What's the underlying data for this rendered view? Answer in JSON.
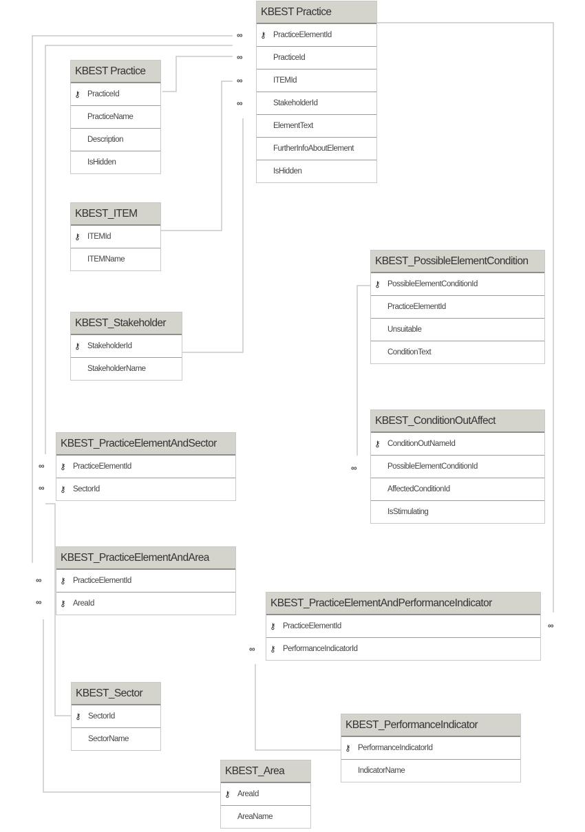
{
  "diagram": {
    "type": "database-schema",
    "line_color": "#c8c8c8",
    "header_color": "#d4d3cc",
    "key_icon": "primary-key-icon",
    "relationship_end_symbol": "∞",
    "tables": [
      {
        "id": "practice_element",
        "name": "KBEST Practice",
        "columns": [
          {
            "name": "PracticeElementId",
            "key": true
          },
          {
            "name": "PracticeId",
            "key": false
          },
          {
            "name": "ITEMId",
            "key": false
          },
          {
            "name": "StakeholderId",
            "key": false
          },
          {
            "name": "ElementText",
            "key": false
          },
          {
            "name": "FurtherInfoAboutElement",
            "key": false
          },
          {
            "name": "IsHidden",
            "key": false
          }
        ]
      },
      {
        "id": "practice",
        "name": "KBEST Practice",
        "columns": [
          {
            "name": "PracticeId",
            "key": true
          },
          {
            "name": "PracticeName",
            "key": false
          },
          {
            "name": "Description",
            "key": false
          },
          {
            "name": "IsHidden",
            "key": false
          }
        ]
      },
      {
        "id": "item",
        "name": "KBEST_ITEM",
        "columns": [
          {
            "name": "ITEMId",
            "key": true
          },
          {
            "name": "ITEMName",
            "key": false
          }
        ]
      },
      {
        "id": "stakeholder",
        "name": "KBEST_Stakeholder",
        "columns": [
          {
            "name": "StakeholderId",
            "key": true
          },
          {
            "name": "StakeholderName",
            "key": false
          }
        ]
      },
      {
        "id": "possible_element_condition",
        "name": "KBEST_PossibleElementCondition",
        "columns": [
          {
            "name": "PossibleElementConditionId",
            "key": true
          },
          {
            "name": "PracticeElementId",
            "key": false
          },
          {
            "name": "Unsuitable",
            "key": false
          },
          {
            "name": "ConditionText",
            "key": false
          }
        ]
      },
      {
        "id": "condition_out_affect",
        "name": "KBEST_ConditionOutAffect",
        "columns": [
          {
            "name": "ConditionOutNameId",
            "key": true
          },
          {
            "name": "PossibleElementConditionId",
            "key": false
          },
          {
            "name": "AffectedConditionId",
            "key": false
          },
          {
            "name": "IsStimulating",
            "key": false
          }
        ]
      },
      {
        "id": "pe_sector",
        "name": "KBEST_PracticeElementAndSector",
        "columns": [
          {
            "name": "PracticeElementId",
            "key": true
          },
          {
            "name": "SectorId",
            "key": true
          }
        ]
      },
      {
        "id": "pe_area",
        "name": "KBEST_PracticeElementAndArea",
        "columns": [
          {
            "name": "PracticeElementId",
            "key": true
          },
          {
            "name": "AreaId",
            "key": true
          }
        ]
      },
      {
        "id": "pe_indicator",
        "name": "KBEST_PracticeElementAndPerformanceIndicator",
        "columns": [
          {
            "name": "PracticeElementId",
            "key": true
          },
          {
            "name": "PerformanceIndicatorId",
            "key": true
          }
        ]
      },
      {
        "id": "sector",
        "name": "KBEST_Sector",
        "columns": [
          {
            "name": "SectorId",
            "key": true
          },
          {
            "name": "SectorName",
            "key": false
          }
        ]
      },
      {
        "id": "indicator",
        "name": "KBEST_PerformanceIndicator",
        "columns": [
          {
            "name": "PerformanceIndicatorId",
            "key": true
          },
          {
            "name": "IndicatorName",
            "key": false
          }
        ]
      },
      {
        "id": "area",
        "name": "KBEST_Area",
        "columns": [
          {
            "name": "AreaId",
            "key": true
          },
          {
            "name": "AreaName",
            "key": false
          }
        ]
      }
    ],
    "relationships": [
      {
        "from": "practice.PracticeId",
        "to": "practice_element.PracticeId",
        "cardinality": "one-to-many"
      },
      {
        "from": "item.ITEMId",
        "to": "practice_element.ITEMId",
        "cardinality": "one-to-many"
      },
      {
        "from": "stakeholder.StakeholderId",
        "to": "practice_element.StakeholderId",
        "cardinality": "one-to-many"
      },
      {
        "from": "practice_element.PracticeElementId",
        "to": "pe_sector.PracticeElementId",
        "cardinality": "one-to-many"
      },
      {
        "from": "practice_element.PracticeElementId",
        "to": "pe_area.PracticeElementId",
        "cardinality": "one-to-many"
      },
      {
        "from": "practice_element.PracticeElementId",
        "to": "pe_indicator.PracticeElementId",
        "cardinality": "one-to-many"
      },
      {
        "from": "sector.SectorId",
        "to": "pe_sector.SectorId",
        "cardinality": "one-to-many"
      },
      {
        "from": "area.AreaId",
        "to": "pe_area.AreaId",
        "cardinality": "one-to-many"
      },
      {
        "from": "indicator.PerformanceIndicatorId",
        "to": "pe_indicator.PerformanceIndicatorId",
        "cardinality": "one-to-many"
      },
      {
        "from": "possible_element_condition.PossibleElementConditionId",
        "to": "condition_out_affect.PossibleElementConditionId",
        "cardinality": "one-to-many"
      }
    ]
  }
}
